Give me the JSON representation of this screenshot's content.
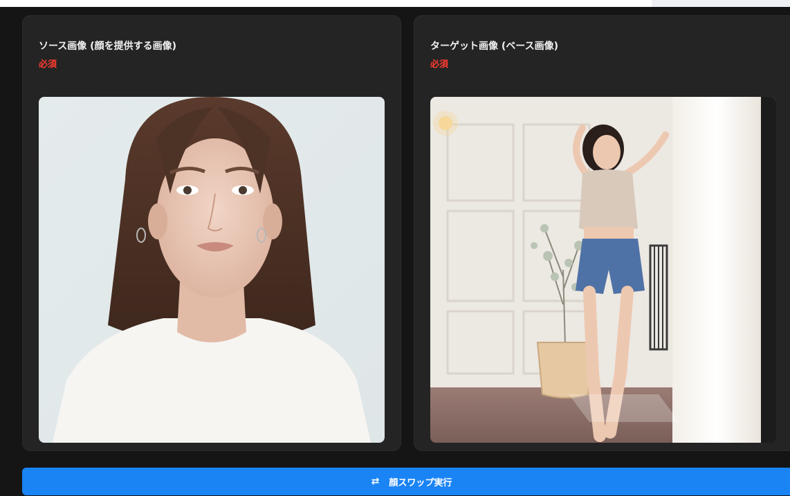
{
  "source_card": {
    "title": "ソース画像 (顔を提供する画像)",
    "required_label": "必須",
    "image_description_icon": "portrait-photo-icon"
  },
  "target_card": {
    "title": "ターゲット画像 (ベース画像)",
    "required_label": "必須",
    "image_description_icon": "full-body-photo-icon"
  },
  "swap_button": {
    "icon": "swap-arrows-icon",
    "icon_glyph": "⇄",
    "label": "顔スワップ実行"
  },
  "colors": {
    "accent": "#1a84f5",
    "required": "#ff3b30",
    "card_bg": "#242424",
    "page_bg": "#151515"
  }
}
